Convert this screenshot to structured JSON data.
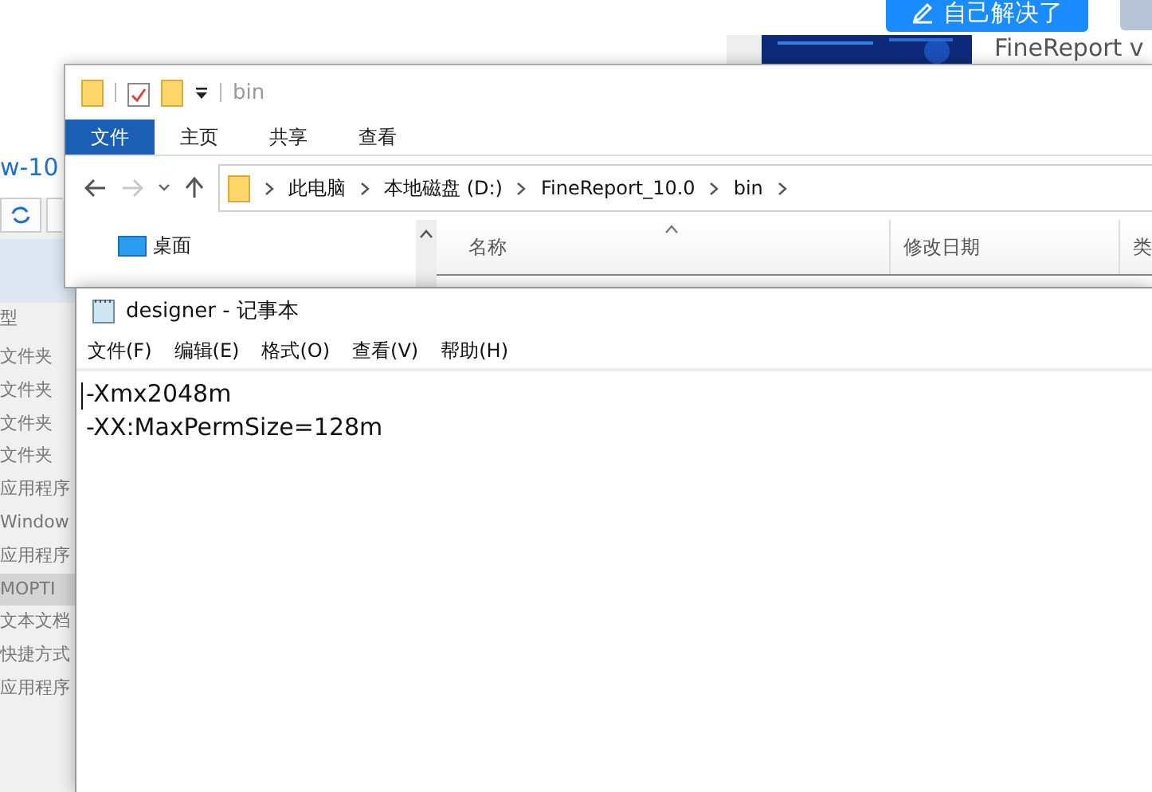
{
  "web": {
    "action_button": "自己解决了",
    "link_text": "w-10",
    "banner_text": "FineReport v",
    "list_header": "型",
    "list_items": [
      {
        "label": "文件夹",
        "selected": false
      },
      {
        "label": "文件夹",
        "selected": false
      },
      {
        "label": "文件夹",
        "selected": false
      },
      {
        "label": "文件夹",
        "selected": false
      },
      {
        "label": "应用程序",
        "selected": false
      },
      {
        "label": "Window",
        "selected": false
      },
      {
        "label": "应用程序",
        "selected": false
      },
      {
        "label": "MOPTI",
        "selected": true
      },
      {
        "label": "文本文档",
        "selected": false
      },
      {
        "label": "快捷方式",
        "selected": false
      },
      {
        "label": "应用程序",
        "selected": false
      }
    ]
  },
  "explorer": {
    "title": "bin",
    "tabs": [
      {
        "label": "文件",
        "selected": true
      },
      {
        "label": "主页",
        "selected": false
      },
      {
        "label": "共享",
        "selected": false
      },
      {
        "label": "查看",
        "selected": false
      }
    ],
    "breadcrumb": [
      "此电脑",
      "本地磁盘 (D:)",
      "FineReport_10.0",
      "bin"
    ],
    "nav_items": [
      "桌面"
    ],
    "columns": [
      "名称",
      "修改日期",
      "类"
    ]
  },
  "notepad": {
    "title": "designer - 记事本",
    "menu": [
      "文件(F)",
      "编辑(E)",
      "格式(O)",
      "查看(V)",
      "帮助(H)"
    ],
    "lines": [
      "-Xmx2048m",
      "-XX:MaxPermSize=128m"
    ]
  }
}
